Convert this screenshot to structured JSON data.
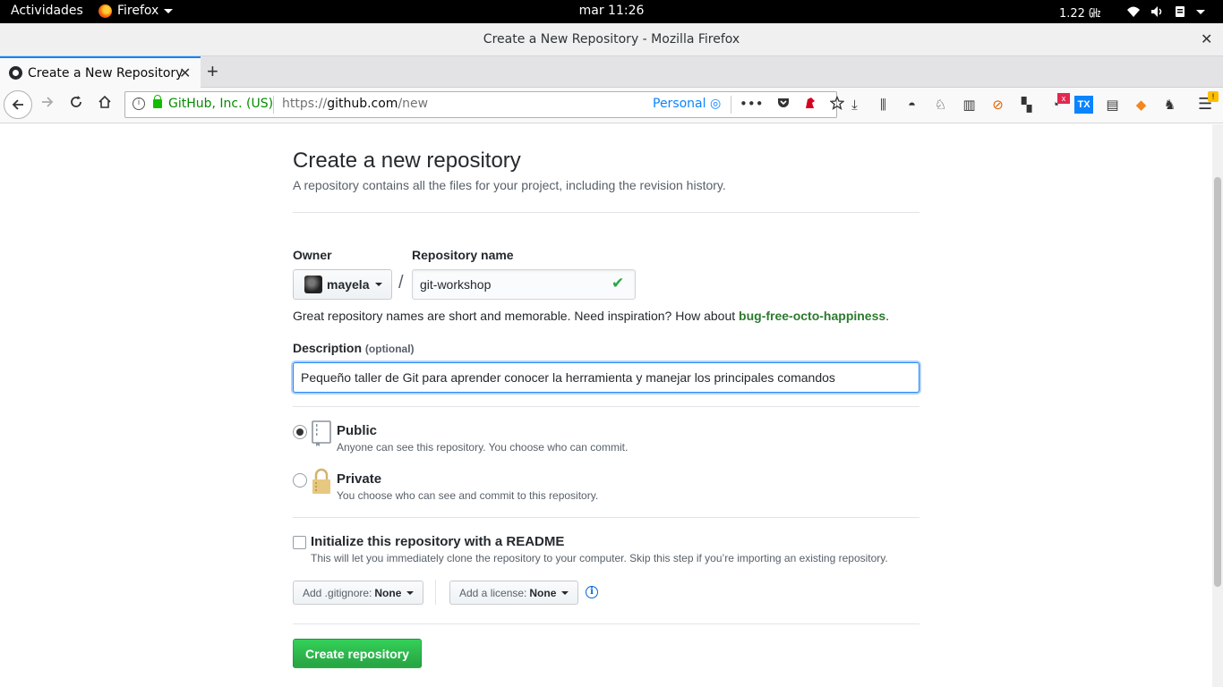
{
  "system": {
    "activities": "Actividades",
    "app_name": "Firefox",
    "clock": "mar 11:26",
    "cpu": "1.22 ㎓"
  },
  "window": {
    "title": "Create a New Repository - Mozilla Firefox",
    "close": "✕"
  },
  "tabs": [
    {
      "label": "Create a New Repository",
      "close": "✕"
    }
  ],
  "newtab": "+",
  "urlbar": {
    "identity": "GitHub, Inc. (US)",
    "url_prefix": "https://",
    "url_host": "github.com",
    "url_path": "/new",
    "container": "Personal",
    "more": "•••"
  },
  "toolbar": {
    "badge": "x",
    "warning": "!"
  },
  "page": {
    "heading": "Create a new repository",
    "subtitle": "A repository contains all the files for your project, including the revision history.",
    "owner_label": "Owner",
    "owner_value": "mayela",
    "slash": "/",
    "repo_label": "Repository name",
    "repo_value": "git-workshop",
    "hint_text": "Great repository names are short and memorable. Need inspiration? How about ",
    "hint_suggestion": "bug-free-octo-happiness",
    "hint_end": ".",
    "desc_label": "Description",
    "desc_optional": "(optional)",
    "desc_value": "Pequeño taller de Git para aprender conocer la herramienta y manejar los principales comandos",
    "public_title": "Public",
    "public_note": "Anyone can see this repository. You choose who can commit.",
    "private_title": "Private",
    "private_note": "You choose who can see and commit to this repository.",
    "init_title": "Initialize this repository with a README",
    "init_note": "This will let you immediately clone the repository to your computer. Skip this step if you’re importing an existing repository.",
    "gitignore_label": "Add .gitignore:",
    "gitignore_value": "None",
    "license_label": "Add a license:",
    "license_value": "None",
    "create_button": "Create repository",
    "selected_visibility": "public",
    "readme_checked": false
  },
  "colors": {
    "accent_green": "#28a745",
    "focus_blue": "#2188ff",
    "firefox_blue": "#0a84ff"
  }
}
